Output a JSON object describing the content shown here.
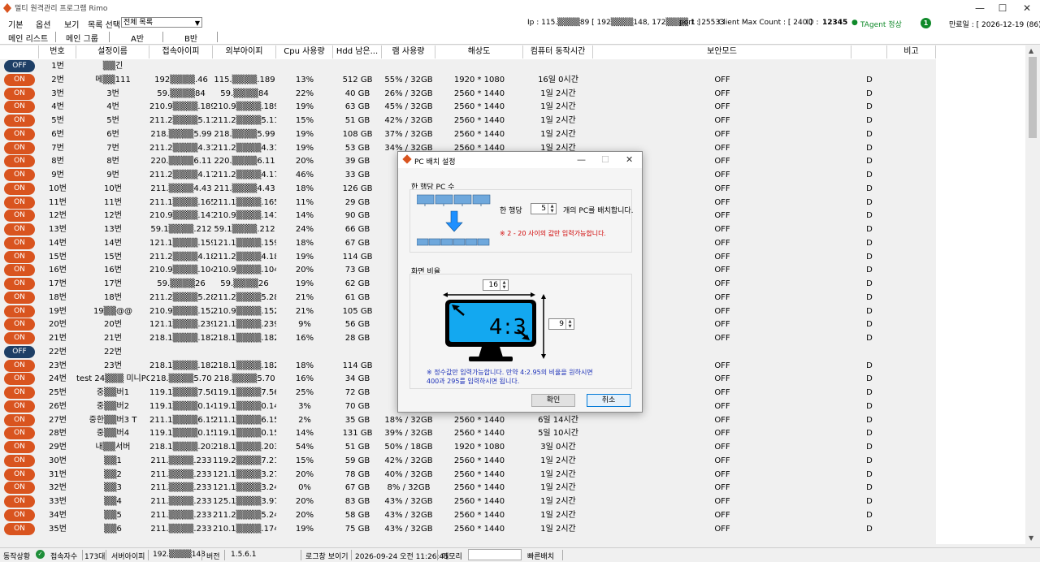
{
  "window": {
    "title": "멀티 원격관리 프로그램 Rimo",
    "minimize": "—",
    "maximize": "☐",
    "close": "✕"
  },
  "menu": {
    "items": [
      "기본",
      "옵션",
      "보기",
      "목록 선택"
    ],
    "combo_value": "전체 목록"
  },
  "info": {
    "ip": "Ip : 115.▒▒▒▒89 [ 192▒▒▒▒148, 172▒▒▒▒.1 ]",
    "port": "port : 25533",
    "max": "Client Max Count :  [ 240 ]",
    "id_label": "ID :",
    "id_value": "12345",
    "agent": "TAgent 정상",
    "badge": "1",
    "expire": "만료일 : [ 2026-12-19 (86) ]"
  },
  "tabs": [
    "메인 리스트",
    "메인 그룹",
    "A반",
    "B반"
  ],
  "columns": [
    "",
    "번호",
    "설정이름",
    "접속아이피",
    "외부아이피",
    "Cpu 사용량",
    "Hdd 남은...",
    "램 사용량",
    "해상도",
    "컴퓨터 동작시간",
    "보안모드",
    "",
    "비고"
  ],
  "rows": [
    {
      "s": "OFF",
      "no": "1번",
      "name": "▒▒긴",
      "ip": "",
      "ext": "",
      "cpu": "",
      "hdd": "",
      "ram": "",
      "res": "",
      "up": "",
      "sec": "",
      "d": ""
    },
    {
      "s": "ON",
      "no": "2번",
      "name": "메▒▒111",
      "ip": "192▒▒▒▒.46",
      "ext": "115.▒▒▒▒.189",
      "cpu": "13%",
      "hdd": "512 GB",
      "ram": "55% / 32GB",
      "res": "1920 * 1080",
      "up": "16일 0시간",
      "sec": "OFF",
      "d": "D"
    },
    {
      "s": "ON",
      "no": "3번",
      "name": "3번",
      "ip": "59.▒▒▒▒84",
      "ext": "59.▒▒▒▒84",
      "cpu": "22%",
      "hdd": "40 GB",
      "ram": "26% / 32GB",
      "res": "2560 * 1440",
      "up": "1일 2시간",
      "sec": "OFF",
      "d": "D"
    },
    {
      "s": "ON",
      "no": "4번",
      "name": "4번",
      "ip": "210.9▒▒▒▒.189",
      "ext": "210.9▒▒▒▒.189",
      "cpu": "19%",
      "hdd": "63 GB",
      "ram": "45% / 32GB",
      "res": "2560 * 1440",
      "up": "1일 2시간",
      "sec": "OFF",
      "d": "D"
    },
    {
      "s": "ON",
      "no": "5번",
      "name": "5번",
      "ip": "211.2▒▒▒▒5.114",
      "ext": "211.2▒▒▒▒5.114",
      "cpu": "15%",
      "hdd": "51 GB",
      "ram": "42% / 32GB",
      "res": "2560 * 1440",
      "up": "1일 2시간",
      "sec": "OFF",
      "d": "D"
    },
    {
      "s": "ON",
      "no": "6번",
      "name": "6번",
      "ip": "218.▒▒▒▒5.99",
      "ext": "218.▒▒▒▒5.99",
      "cpu": "19%",
      "hdd": "108 GB",
      "ram": "37% / 32GB",
      "res": "2560 * 1440",
      "up": "1일 2시간",
      "sec": "OFF",
      "d": "D"
    },
    {
      "s": "ON",
      "no": "7번",
      "name": "7번",
      "ip": "211.2▒▒▒▒4.31",
      "ext": "211.2▒▒▒▒4.31",
      "cpu": "19%",
      "hdd": "53 GB",
      "ram": "34% / 32GB",
      "res": "2560 * 1440",
      "up": "1일 2시간",
      "sec": "OFF",
      "d": "D"
    },
    {
      "s": "ON",
      "no": "8번",
      "name": "8번",
      "ip": "220.▒▒▒▒6.11",
      "ext": "220.▒▒▒▒6.11",
      "cpu": "20%",
      "hdd": "39 GB",
      "ram": "41%",
      "res": "",
      "up": "",
      "sec": "OFF",
      "d": "D"
    },
    {
      "s": "ON",
      "no": "9번",
      "name": "9번",
      "ip": "211.2▒▒▒▒4.179",
      "ext": "211.2▒▒▒▒4.179",
      "cpu": "46%",
      "hdd": "33 GB",
      "ram": "50%",
      "res": "",
      "up": "",
      "sec": "OFF",
      "d": "D"
    },
    {
      "s": "ON",
      "no": "10번",
      "name": "10번",
      "ip": "211.▒▒▒▒4.43",
      "ext": "211.▒▒▒▒4.43",
      "cpu": "18%",
      "hdd": "126 GB",
      "ram": "38%",
      "res": "",
      "up": "",
      "sec": "OFF",
      "d": "D"
    },
    {
      "s": "ON",
      "no": "11번",
      "name": "11번",
      "ip": "211.1▒▒▒▒.165",
      "ext": "211.1▒▒▒▒.165",
      "cpu": "11%",
      "hdd": "29 GB",
      "ram": "35%",
      "res": "",
      "up": "",
      "sec": "OFF",
      "d": "D"
    },
    {
      "s": "ON",
      "no": "12번",
      "name": "12번",
      "ip": "210.9▒▒▒▒.141",
      "ext": "210.9▒▒▒▒.141",
      "cpu": "14%",
      "hdd": "90 GB",
      "ram": "28%",
      "res": "",
      "up": "",
      "sec": "OFF",
      "d": "D"
    },
    {
      "s": "ON",
      "no": "13번",
      "name": "13번",
      "ip": "59.1▒▒▒▒.212",
      "ext": "59.1▒▒▒▒.212",
      "cpu": "24%",
      "hdd": "66 GB",
      "ram": "23%",
      "res": "",
      "up": "",
      "sec": "OFF",
      "d": "D"
    },
    {
      "s": "ON",
      "no": "14번",
      "name": "14번",
      "ip": "121.1▒▒▒▒.159",
      "ext": "121.1▒▒▒▒.159",
      "cpu": "18%",
      "hdd": "67 GB",
      "ram": "24%",
      "res": "",
      "up": "",
      "sec": "OFF",
      "d": "D"
    },
    {
      "s": "ON",
      "no": "15번",
      "name": "15번",
      "ip": "211.2▒▒▒▒4.184",
      "ext": "211.2▒▒▒▒4.184",
      "cpu": "19%",
      "hdd": "114 GB",
      "ram": "38%",
      "res": "",
      "up": "",
      "sec": "OFF",
      "d": "D"
    },
    {
      "s": "ON",
      "no": "16번",
      "name": "16번",
      "ip": "210.9▒▒▒▒.104",
      "ext": "210.9▒▒▒▒.104",
      "cpu": "20%",
      "hdd": "73 GB",
      "ram": "15%",
      "res": "",
      "up": "",
      "sec": "OFF",
      "d": "D"
    },
    {
      "s": "ON",
      "no": "17번",
      "name": "17번",
      "ip": "59.▒▒▒▒26",
      "ext": "59.▒▒▒▒26",
      "cpu": "19%",
      "hdd": "62 GB",
      "ram": "21%",
      "res": "",
      "up": "",
      "sec": "OFF",
      "d": "D"
    },
    {
      "s": "ON",
      "no": "18번",
      "name": "18번",
      "ip": "211.2▒▒▒▒5.28",
      "ext": "211.2▒▒▒▒5.28",
      "cpu": "21%",
      "hdd": "61 GB",
      "ram": "20%",
      "res": "",
      "up": "",
      "sec": "OFF",
      "d": "D"
    },
    {
      "s": "ON",
      "no": "19번",
      "name": "19▒▒@@",
      "ip": "210.9▒▒▒▒.152",
      "ext": "210.9▒▒▒▒.152",
      "cpu": "21%",
      "hdd": "105 GB",
      "ram": "33%",
      "res": "",
      "up": "",
      "sec": "OFF",
      "d": "D"
    },
    {
      "s": "ON",
      "no": "20번",
      "name": "20번",
      "ip": "121.1▒▒▒▒.239",
      "ext": "121.1▒▒▒▒.239",
      "cpu": "9%",
      "hdd": "56 GB",
      "ram": "8%",
      "res": "",
      "up": "",
      "sec": "OFF",
      "d": "D"
    },
    {
      "s": "ON",
      "no": "21번",
      "name": "21번",
      "ip": "218.1▒▒▒▒.182",
      "ext": "218.1▒▒▒▒.182",
      "cpu": "16%",
      "hdd": "28 GB",
      "ram": "25%",
      "res": "",
      "up": "",
      "sec": "OFF",
      "d": "D"
    },
    {
      "s": "OFF",
      "no": "22번",
      "name": "22번",
      "ip": "",
      "ext": "",
      "cpu": "",
      "hdd": "",
      "ram": "",
      "res": "",
      "up": "",
      "sec": "",
      "d": ""
    },
    {
      "s": "ON",
      "no": "23번",
      "name": "23번",
      "ip": "218.1▒▒▒▒.182",
      "ext": "218.1▒▒▒▒.182",
      "cpu": "18%",
      "hdd": "114 GB",
      "ram": "30%",
      "res": "",
      "up": "",
      "sec": "OFF",
      "d": "D"
    },
    {
      "s": "ON",
      "no": "24번",
      "name": "test 24▒▒▒ 미니PC",
      "ip": "218.▒▒▒▒5.70",
      "ext": "218.▒▒▒▒5.70",
      "cpu": "16%",
      "hdd": "34 GB",
      "ram": "52%",
      "res": "",
      "up": "",
      "sec": "OFF",
      "d": "D"
    },
    {
      "s": "ON",
      "no": "25번",
      "name": "중▒▒버1",
      "ip": "119.1▒▒▒▒7.56",
      "ext": "119.1▒▒▒▒7.56",
      "cpu": "25%",
      "hdd": "72 GB",
      "ram": "34%",
      "res": "",
      "up": "",
      "sec": "OFF",
      "d": "D"
    },
    {
      "s": "ON",
      "no": "26번",
      "name": "중▒▒버2",
      "ip": "119.1▒▒▒▒0.149",
      "ext": "119.1▒▒▒▒0.149",
      "cpu": "3%",
      "hdd": "70 GB",
      "ram": "25%",
      "res": "",
      "up": "",
      "sec": "OFF",
      "d": "D"
    },
    {
      "s": "ON",
      "no": "27번",
      "name": "중한▒▒버3 T",
      "ip": "211.1▒▒▒▒6.154",
      "ext": "211.1▒▒▒▒6.154",
      "cpu": "2%",
      "hdd": "35 GB",
      "ram": "18% / 32GB",
      "res": "2560 * 1440",
      "up": "6일 14시간",
      "sec": "OFF",
      "d": "D"
    },
    {
      "s": "ON",
      "no": "28번",
      "name": "중▒▒버4",
      "ip": "119.1▒▒▒▒0.156",
      "ext": "119.1▒▒▒▒0.156",
      "cpu": "14%",
      "hdd": "131 GB",
      "ram": "39% / 32GB",
      "res": "2560 * 1440",
      "up": "5일 10시간",
      "sec": "OFF",
      "d": "D"
    },
    {
      "s": "ON",
      "no": "29번",
      "name": "내▒▒서버",
      "ip": "218.1▒▒▒▒.203",
      "ext": "218.1▒▒▒▒.203",
      "cpu": "54%",
      "hdd": "51 GB",
      "ram": "50% / 18GB",
      "res": "1920 * 1080",
      "up": "3일 0시간",
      "sec": "OFF",
      "d": "D"
    },
    {
      "s": "ON",
      "no": "30번",
      "name": "▒▒1",
      "ip": "211.▒▒▒▒.233",
      "ext": "119.2▒▒▒▒7.217",
      "cpu": "15%",
      "hdd": "59 GB",
      "ram": "42% / 32GB",
      "res": "2560 * 1440",
      "up": "1일 2시간",
      "sec": "OFF",
      "d": "D"
    },
    {
      "s": "ON",
      "no": "31번",
      "name": "▒▒2",
      "ip": "211.▒▒▒▒.233",
      "ext": "121.1▒▒▒▒3.27",
      "cpu": "20%",
      "hdd": "78 GB",
      "ram": "40% / 32GB",
      "res": "2560 * 1440",
      "up": "1일 2시간",
      "sec": "OFF",
      "d": "D"
    },
    {
      "s": "ON",
      "no": "32번",
      "name": "▒▒3",
      "ip": "211.▒▒▒▒.233",
      "ext": "121.1▒▒▒▒3.240",
      "cpu": "0%",
      "hdd": "67 GB",
      "ram": "8% / 32GB",
      "res": "2560 * 1440",
      "up": "1일 2시간",
      "sec": "OFF",
      "d": "D"
    },
    {
      "s": "ON",
      "no": "33번",
      "name": "▒▒4",
      "ip": "211.▒▒▒▒.233",
      "ext": "125.1▒▒▒▒3.97",
      "cpu": "20%",
      "hdd": "83 GB",
      "ram": "43% / 32GB",
      "res": "2560 * 1440",
      "up": "1일 2시간",
      "sec": "OFF",
      "d": "D"
    },
    {
      "s": "ON",
      "no": "34번",
      "name": "▒▒5",
      "ip": "211.▒▒▒▒.233",
      "ext": "211.2▒▒▒▒5.245",
      "cpu": "20%",
      "hdd": "58 GB",
      "ram": "43% / 32GB",
      "res": "2560 * 1440",
      "up": "1일 2시간",
      "sec": "OFF",
      "d": "D"
    },
    {
      "s": "ON",
      "no": "35번",
      "name": "▒▒6",
      "ip": "211.▒▒▒▒.233",
      "ext": "210.1▒▒▒▒.174",
      "cpu": "19%",
      "hdd": "75 GB",
      "ram": "43% / 32GB",
      "res": "2560 * 1440",
      "up": "1일 2시간",
      "sec": "OFF",
      "d": "D"
    }
  ],
  "status": {
    "label": "동작상황",
    "conn_label": "접속자수",
    "conn_value": "173대",
    "server_ip_label": "서버아이피",
    "server_ip": "192.▒▒▒▒148",
    "ver_label": "버전",
    "ver_value": "1.5.6.1",
    "log_btn": "로그창 보이기",
    "datetime": "2026-09-24 오전 11:26:45",
    "mem_label": "메모리",
    "fast": "빠른배치"
  },
  "dialog": {
    "title": "PC 배치 설정",
    "group1": "한 행당 PC 수",
    "row_prefix": "한 행당",
    "row_value": "5",
    "row_suffix": "개의 PC를 배치합니다.",
    "row_note": "※ 2 - 20 사이의 값만 입력가능합니다.",
    "group2": "화면 비율",
    "ratio_w": "16",
    "ratio_h": "9",
    "ratio_label": "4:3",
    "note_line1": "※ 정수값만 입력가능합니다. 만약 4:2.95의 비율을 원하시면",
    "note_line2": "400과 295를 입력하시면 됩니다.",
    "ok": "확인",
    "cancel": "취소"
  }
}
